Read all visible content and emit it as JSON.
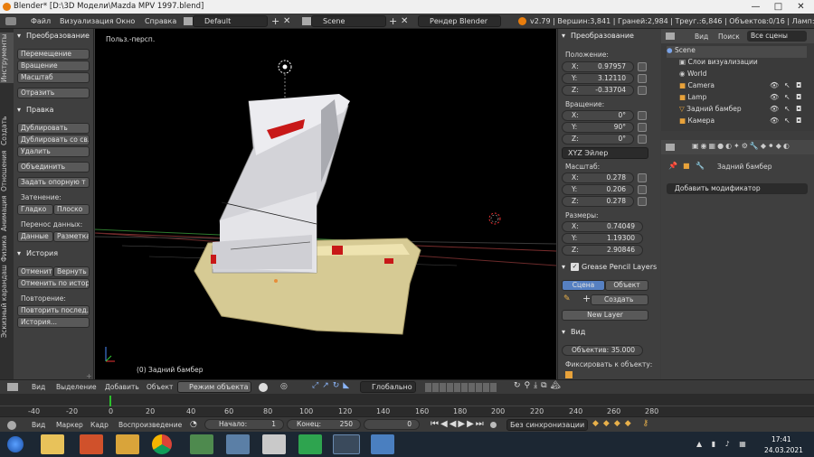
{
  "title": "Blender* [D:\\3D Модели\\Mazda MPV 1997.blend]",
  "info": {
    "menus": [
      "Файл",
      "Визуализация",
      "Окно",
      "Справка"
    ],
    "layout": "Default",
    "scene": "Scene",
    "engine": "Рендер Blender",
    "stats": "v2.79 | Вершин:3,841 | Граней:2,984 | Треуг.:6,846 | Объектов:0/16 | Ламп:0/2 | Ма"
  },
  "left_tabs": [
    "Инструменты",
    "Создать",
    "Отношения",
    "Анимация",
    "Физика",
    "Эскизный карандаш"
  ],
  "toolshelf": {
    "transform_header": "Преобразование",
    "move": "Перемещение",
    "rotate": "Вращение",
    "scale": "Масштаб",
    "mirror": "Отразить",
    "edit_header": "Правка",
    "duplicate": "Дублировать",
    "duplicate_linked": "Дублировать со св...",
    "delete": "Удалить",
    "join": "Объединить",
    "set_origin": "Задать опорную т",
    "shading_label": "Затенение:",
    "smooth": "Гладко",
    "flat": "Плоско",
    "data_transfer_label": "Перенос данных:",
    "data": "Данные",
    "layout_btn": "Разметка",
    "history_header": "История",
    "undo": "Отменит",
    "redo": "Вернуть",
    "undo_history": "Отменить по истор...",
    "repeat_label": "Повторение:",
    "repeat_last": "Повторить послед...",
    "history": "История..."
  },
  "viewport": {
    "view_name": "Польз.-персп.",
    "object_label": "(0) Задний бамбер"
  },
  "npanel": {
    "transform_header": "Преобразование",
    "location_label": "Положение:",
    "location": [
      {
        "k": "X:",
        "v": "0.97957"
      },
      {
        "k": "Y:",
        "v": "3.12110"
      },
      {
        "k": "Z:",
        "v": "-0.33704"
      }
    ],
    "rotation_label": "Вращение:",
    "rotation": [
      {
        "k": "X:",
        "v": "0°"
      },
      {
        "k": "Y:",
        "v": "90°"
      },
      {
        "k": "Z:",
        "v": "0°"
      }
    ],
    "rotation_mode": "XYZ Эйлер",
    "scale_label": "Масштаб:",
    "scale": [
      {
        "k": "X:",
        "v": "0.278"
      },
      {
        "k": "Y:",
        "v": "0.206"
      },
      {
        "k": "Z:",
        "v": "0.278"
      }
    ],
    "dimensions_label": "Размеры:",
    "dimensions": [
      {
        "k": "X:",
        "v": "0.74049"
      },
      {
        "k": "Y:",
        "v": "1.19300"
      },
      {
        "k": "Z:",
        "v": "2.90846"
      }
    ],
    "grease_header": "Grease Pencil Layers",
    "tab_scene": "Сцена",
    "tab_object": "Объект",
    "create": "Создать",
    "new_layer": "New Layer",
    "view_header": "Вид",
    "lens_key": "Объектив:",
    "lens_val": "35.000",
    "lock_label": "Фиксировать к объекту:"
  },
  "outliner": {
    "tabs": [
      "Вид",
      "Поиск",
      "Все сцены"
    ],
    "rows": [
      "Scene",
      "Слои визуализации",
      "World",
      "Camera",
      "Lamp",
      "Задний бамбер",
      "Камера"
    ]
  },
  "props": {
    "object_name": "Задний бамбер",
    "add_modifier": "Добавить модификатор"
  },
  "vpheader": {
    "view": "Вид",
    "select": "Выделение",
    "add": "Добавить",
    "object": "Объект",
    "mode": "Режим объекта",
    "orientation": "Глобально"
  },
  "timeline": {
    "ticks": [
      "-40",
      "-20",
      "0",
      "20",
      "40",
      "60",
      "80",
      "100",
      "120",
      "140",
      "160",
      "180",
      "200",
      "220",
      "240",
      "260",
      "280"
    ],
    "menus": [
      "Вид",
      "Маркер",
      "Кадр",
      "Воспроизведение"
    ],
    "start_key": "Начало:",
    "start_val": "1",
    "end_key": "Конец:",
    "end_val": "250",
    "current": "0",
    "sync": "Без синхронизации"
  },
  "taskbar": {
    "time": "17:41",
    "date": "24.03.2021"
  }
}
